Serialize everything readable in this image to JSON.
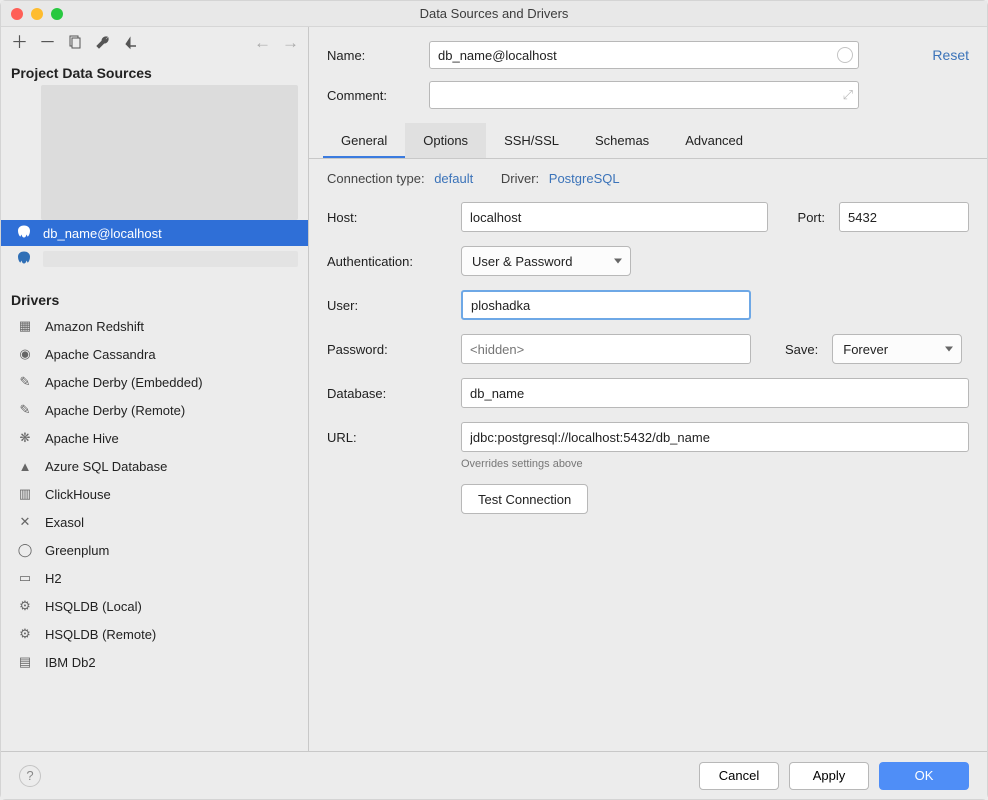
{
  "window": {
    "title": "Data Sources and Drivers"
  },
  "sidebar": {
    "sections": {
      "project": "Project Data Sources",
      "drivers": "Drivers"
    },
    "selected": "db_name@localhost",
    "drivers": [
      "Amazon Redshift",
      "Apache Cassandra",
      "Apache Derby (Embedded)",
      "Apache Derby (Remote)",
      "Apache Hive",
      "Azure SQL Database",
      "ClickHouse",
      "Exasol",
      "Greenplum",
      "H2",
      "HSQLDB (Local)",
      "HSQLDB (Remote)",
      "IBM Db2"
    ]
  },
  "form": {
    "name_label": "Name:",
    "name_value": "db_name@localhost",
    "comment_label": "Comment:",
    "comment_value": "",
    "reset": "Reset"
  },
  "tabs": [
    "General",
    "Options",
    "SSH/SSL",
    "Schemas",
    "Advanced"
  ],
  "active_tab": "Options",
  "underline_tab": "General",
  "conn": {
    "type_label": "Connection type:",
    "type_value": "default",
    "driver_label": "Driver:",
    "driver_value": "PostgreSQL",
    "host_label": "Host:",
    "host_value": "localhost",
    "port_label": "Port:",
    "port_value": "5432",
    "auth_label": "Authentication:",
    "auth_value": "User & Password",
    "user_label": "User:",
    "user_value": "ploshadka",
    "password_label": "Password:",
    "password_placeholder": "<hidden>",
    "password_value": "",
    "save_label": "Save:",
    "save_value": "Forever",
    "database_label": "Database:",
    "database_value": "db_name",
    "url_label": "URL:",
    "url_value": "jdbc:postgresql://localhost:5432/db_name",
    "override_note": "Overrides settings above",
    "test_button": "Test Connection"
  },
  "footer": {
    "cancel": "Cancel",
    "apply": "Apply",
    "ok": "OK"
  }
}
